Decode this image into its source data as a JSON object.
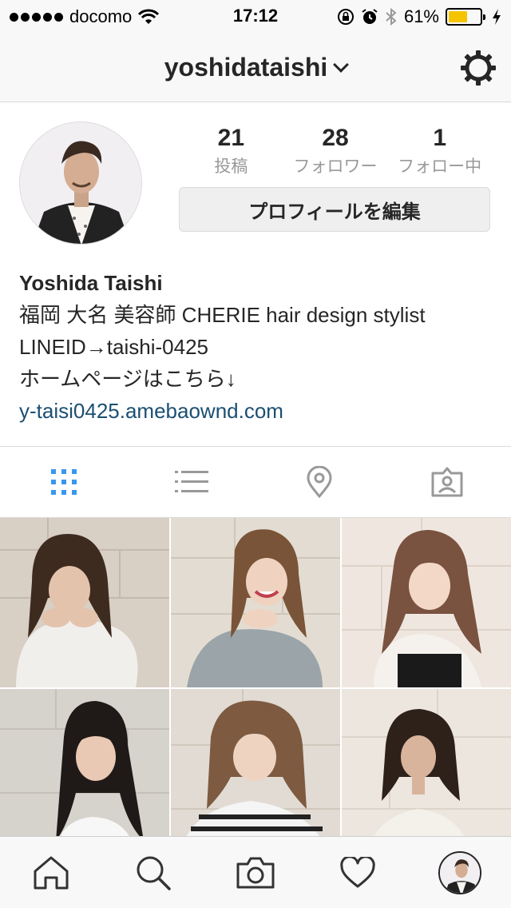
{
  "status_bar": {
    "carrier": "docomo",
    "time": "17:12",
    "battery_percent": "61%",
    "battery_level": 0.61,
    "icons": [
      "signal-dots",
      "wifi-icon",
      "orientation-lock-icon",
      "alarm-icon",
      "bluetooth-icon",
      "battery-icon",
      "charging-icon"
    ]
  },
  "header": {
    "username": "yoshidataishi",
    "icons": [
      "chevron-down-icon",
      "gear-icon"
    ]
  },
  "profile": {
    "posts": {
      "count": "21",
      "label": "投稿"
    },
    "followers": {
      "count": "28",
      "label": "フォロワー"
    },
    "following": {
      "count": "1",
      "label": "フォロー中"
    },
    "edit_button": "プロフィールを編集",
    "bio": {
      "name": "Yoshida Taishi",
      "line1": "福岡 大名 美容師 CHERIE hair design stylist",
      "line2": "LINEID→taishi-0425",
      "line3": "ホームページはこちら↓",
      "link": "y-taisi0425.amebaownd.com"
    }
  },
  "tabs": {
    "icons": [
      "grid-icon",
      "list-icon",
      "location-pin-icon",
      "tagged-photos-icon"
    ],
    "active_color": "#3897f0",
    "inactive_color": "#999999"
  },
  "grid": {
    "photos": [
      "photo-1",
      "photo-2",
      "photo-3",
      "photo-4",
      "photo-5",
      "photo-6"
    ]
  },
  "bottom_bar": {
    "icons": [
      "home-icon",
      "search-icon",
      "camera-icon",
      "heart-icon",
      "profile-avatar"
    ]
  },
  "colors": {
    "link": "#1b4f72",
    "battery": "#f5c400"
  }
}
